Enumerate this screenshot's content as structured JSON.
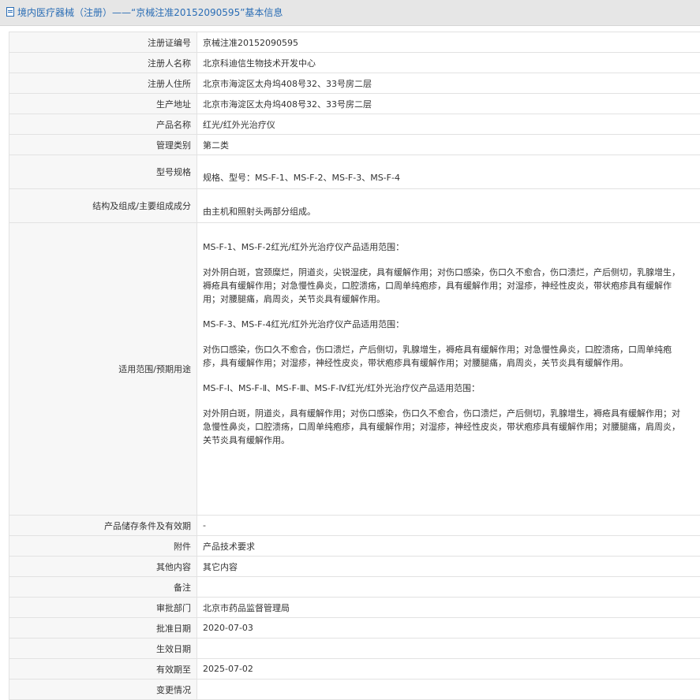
{
  "header": {
    "title": "境内医疗器械（注册）——“京械注准20152090595”基本信息",
    "icon": "document-icon",
    "color": "#2a6db5"
  },
  "fields": {
    "reg_no": {
      "label": "注册证编号",
      "value": "京械注准20152090595"
    },
    "registrant": {
      "label": "注册人名称",
      "value": "北京科迪信生物技术开发中心"
    },
    "address": {
      "label": "注册人住所",
      "value": "北京市海淀区太舟坞408号32、33号房二层"
    },
    "production": {
      "label": "生产地址",
      "value": "北京市海淀区太舟坞408号32、33号房二层"
    },
    "product": {
      "label": "产品名称",
      "value": "红光/红外光治疗仪"
    },
    "category": {
      "label": "管理类别",
      "value": "第二类"
    },
    "model": {
      "label": "型号规格",
      "value": "规格、型号：MS-F-1、MS-F-2、MS-F-3、MS-F-4"
    },
    "structure": {
      "label": "结构及组成/主要组成成分",
      "value": "由主机和照射头两部分组成。"
    },
    "scope": {
      "label": "适用范围/预期用途",
      "paragraphs": [
        "MS-F-1、MS-F-2红光/红外光治疗仪产品适用范围：",
        "对外阴白斑，宫颈糜烂，阴道炎，尖锐湿疣，具有缓解作用；对伤口感染，伤口久不愈合，伤口溃烂，产后侧切，乳腺增生，褥疮具有缓解作用；对急慢性鼻炎，口腔溃疡，口周单纯疱疹，具有缓解作用；对湿疹，神经性皮炎，带状疱疹具有缓解作用；对腰腿痛，肩周炎，关节炎具有缓解作用。",
        "MS-F-3、MS-F-4红光/红外光治疗仪产品适用范围：",
        "对伤口感染，伤口久不愈合，伤口溃烂，产后侧切，乳腺增生，褥疮具有缓解作用；对急慢性鼻炎，口腔溃疡，口周单纯疱疹，具有缓解作用；对湿疹，神经性皮炎，带状疱疹具有缓解作用；对腰腿痛，肩周炎，关节炎具有缓解作用。",
        "MS-F-Ⅰ、MS-F-Ⅱ、MS-F-Ⅲ、MS-F-Ⅳ红光/红外光治疗仪产品适用范围：",
        "对外阴白斑，阴道炎，具有缓解作用；对伤口感染，伤口久不愈合，伤口溃烂，产后侧切，乳腺增生，褥疮具有缓解作用；对急慢性鼻炎，口腔溃疡，口周单纯疱疹，具有缓解作用；对湿疹，神经性皮炎，带状疱疹具有缓解作用；对腰腿痛，肩周炎，关节炎具有缓解作用。"
      ]
    },
    "storage": {
      "label": "产品储存条件及有效期",
      "value": "-"
    },
    "attachment": {
      "label": "附件",
      "value": "产品技术要求"
    },
    "other": {
      "label": "其他内容",
      "value": "其它内容"
    },
    "remarks": {
      "label": "备注",
      "value": ""
    },
    "dept": {
      "label": "审批部门",
      "value": "北京市药品监督管理局"
    },
    "approval_date": {
      "label": "批准日期",
      "value": "2020-07-03"
    },
    "effective_date": {
      "label": "生效日期",
      "value": ""
    },
    "expiry": {
      "label": "有效期至",
      "value": "2025-07-02"
    },
    "changes": {
      "label": "变更情况",
      "value": ""
    }
  }
}
